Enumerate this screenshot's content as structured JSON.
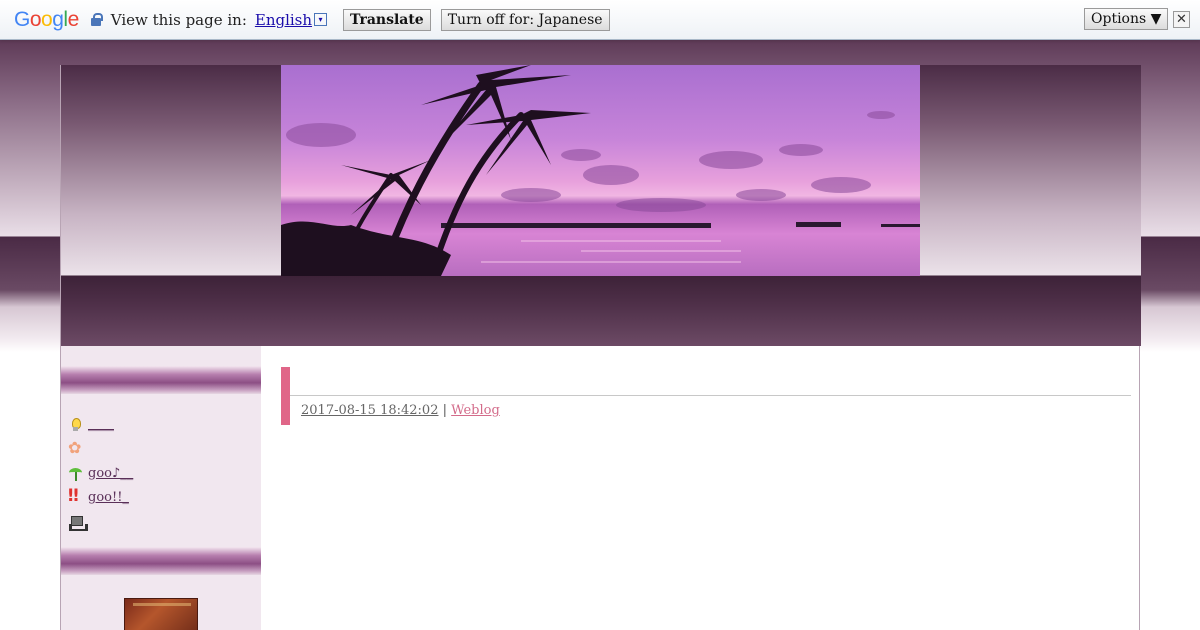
{
  "translate_bar": {
    "logo": [
      "G",
      "o",
      "o",
      "g",
      "l",
      "e"
    ],
    "logo_colors": [
      "#4285f4",
      "#ea4335",
      "#fbbc05",
      "#4285f4",
      "#34a853",
      "#ea4335"
    ],
    "view_label": "View this page in:",
    "language": "English",
    "dropdown_glyph": "▾",
    "translate_button": "Translate",
    "turn_off_button": "Turn off for: Japanese",
    "options_button": "Options ▼",
    "close_glyph": "✕"
  },
  "sidebar": {
    "items": [
      {
        "icon": "bulb-icon",
        "label": "____"
      },
      {
        "icon": "flower-icon",
        "label": ""
      },
      {
        "icon": "sprout-icon",
        "label": "goo♪__"
      },
      {
        "icon": "exclaim-icon",
        "label": "goo!!_"
      },
      {
        "icon": "robot-icon",
        "label": ""
      }
    ]
  },
  "entry": {
    "date": "2017-08-15 18:42:02",
    "separator": "|",
    "category": "Weblog"
  },
  "colors": {
    "header_dark": "#4b2c46",
    "sidebar_bg": "#f1e7ef",
    "entry_accent": "#e06688",
    "category_link": "#d36b8a"
  }
}
